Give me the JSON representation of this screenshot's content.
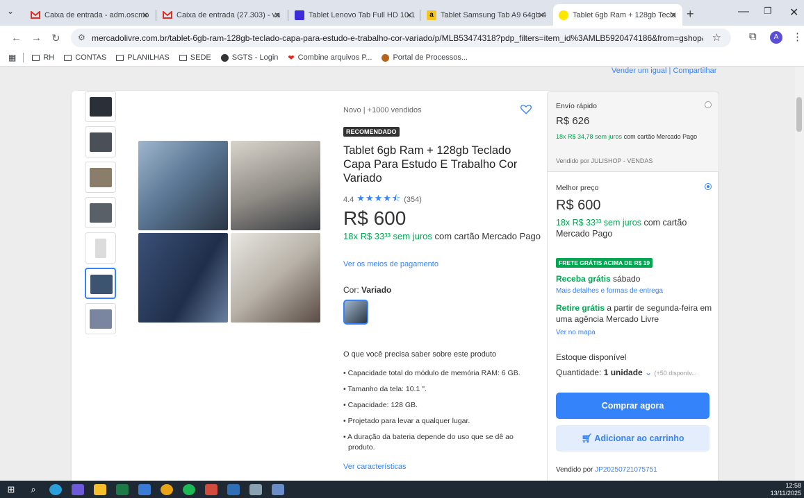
{
  "browser": {
    "tabs": [
      {
        "title": "Caixa de entrada - adm.oscmo",
        "icon": "gmail-icon"
      },
      {
        "title": "Caixa de entrada (27.303) - va",
        "icon": "gmail-icon"
      },
      {
        "title": "Tablet Lenovo Tab Full HD 10.1",
        "icon": "bookmark-icon"
      },
      {
        "title": "Tablet Samsung Tab A9 64gb 4",
        "icon": "amazon-icon"
      },
      {
        "title": "Tablet 6gb Ram + 128gb Tecla",
        "icon": "mercadolivre-icon"
      }
    ],
    "url": "mercadolivre.com.br/tablet-6gb-ram-128gb-teclado-capa-para-estudo-e-trabalho-cor-variado/p/MLB53474318?pdp_filters=item_id%3AMLB5920474186&from=gshop&matt_t...",
    "profile_initial": "A",
    "bookmarks": [
      "RH",
      "CONTAS",
      "PLANILHAS",
      "SEDE",
      "SGTS - Login",
      "Combine arquivos P...",
      "Portal de Processos..."
    ]
  },
  "product": {
    "top_links": "Vender um igual | Compartilhar",
    "state": "Novo  |  +1000 vendidos",
    "badge": "RECOMENDADO",
    "title": "Tablet 6gb Ram + 128gb Teclado Capa Para Estudo E Trabalho Cor Variado",
    "rating": "4.4",
    "reviews": "(354)",
    "stars_value": 4.4,
    "price": "R$ 600",
    "installments_green": "18x R$ 33³³ sem juros",
    "installments_rest": " com cartão Mercado Pago",
    "pay_link": "Ver os meios de pagamento",
    "color_label": "Cor: ",
    "color_value": "Variado",
    "know_heading": "O que você precisa saber sobre este produto",
    "features": [
      "• Capacidade total do módulo de memória RAM: 6 GB.",
      "• Tamanho da tela: 10.1 \".",
      "• Capacidade: 128 GB.",
      "• Projetado para levar a qualquer lugar.",
      "• A duração da bateria depende do uso que se dê ao produto."
    ],
    "features_link": "Ver características"
  },
  "aside": {
    "opt1": {
      "label": "Envío rápido",
      "price": "R$ 626",
      "inst_green": "18x R$ 34,78 sem juros",
      "inst_rest": " com cartão Mercado Pago",
      "seller": "Vendido por JULISHOP - VENDAS"
    },
    "opt2": {
      "label": "Melhor preço",
      "price": "R$ 600",
      "inst_green": "18x R$ 33³³ sem juros",
      "inst_rest": " com cartão Mercado Pago",
      "frete": "FRETE GRÁTIS ACIMA DE R$ 19",
      "receba_green": "Receba grátis",
      "receba_rest": " sábado",
      "details_link": "Mais detalhes e formas de entrega",
      "retire_green": "Retire grátis",
      "retire_rest": " a partir de segunda-feira em uma agência Mercado Livre",
      "map_link": "Ver no mapa",
      "stock": "Estoque disponível",
      "qty_label": "Quantidade: ",
      "qty_value": "1 unidade",
      "qty_avail": "(+50 disponív...",
      "buy": "Comprar agora",
      "cart": "Adicionar ao carrinho",
      "seller_label": "Vendido por ",
      "seller_name": "JP20250721075751"
    }
  },
  "taskbar": {
    "time": "12:58",
    "date": "13/11/2025"
  },
  "colors": {
    "accent": "#3483fa",
    "green": "#00a650"
  }
}
